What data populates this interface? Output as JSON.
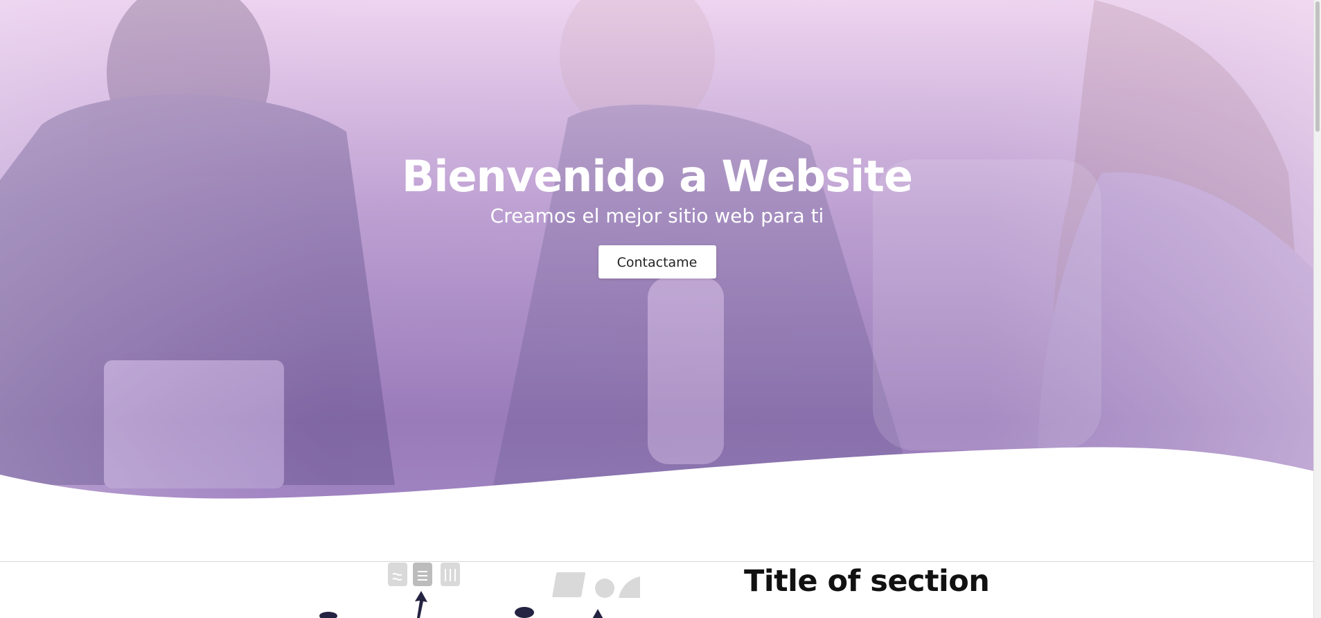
{
  "hero": {
    "title": "Bienvenido a Website",
    "subtitle": "Creamos el mejor sitio web para ti",
    "button_label": "Contactame",
    "overlay_color": "#8b6ab0"
  },
  "section": {
    "title": "Title of section"
  },
  "colors": {
    "accent": "#7d5ea8",
    "text_dark": "#111111",
    "white": "#ffffff"
  }
}
